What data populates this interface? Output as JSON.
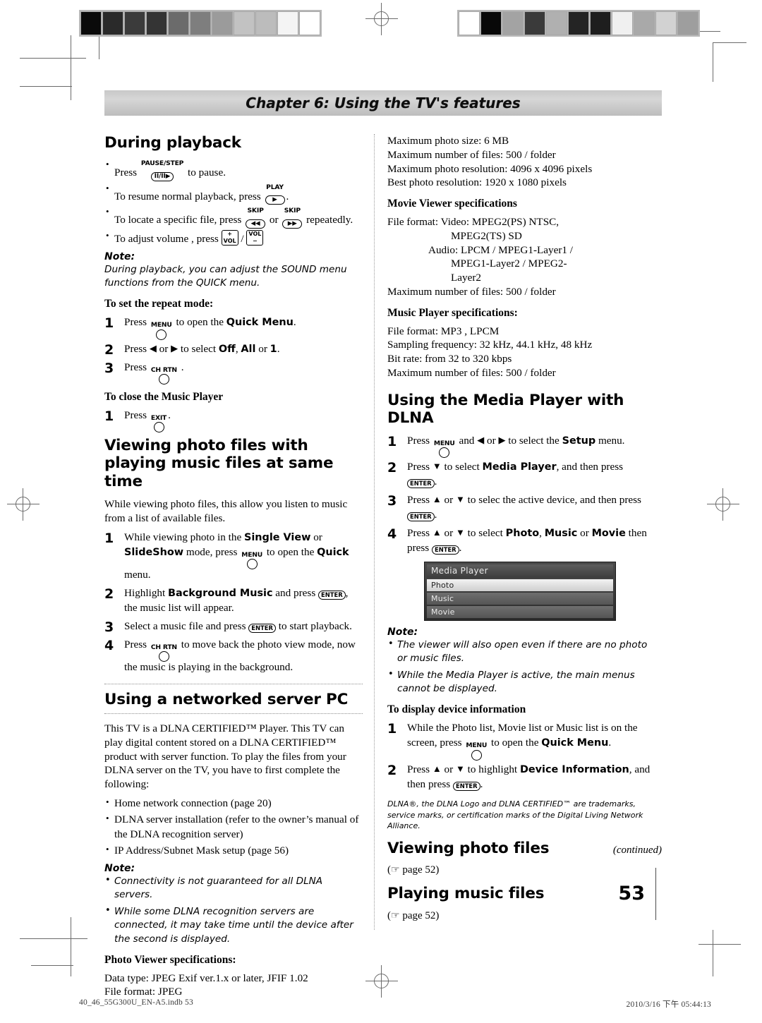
{
  "chapter": {
    "banner": "Chapter 6: Using the TV's features"
  },
  "folio": {
    "page_number": "53",
    "continued": "(continued)"
  },
  "imprint": {
    "file": "40_46_55G300U_EN-A5.indb   53",
    "timestamp": "2010/3/16   下午 05:44:13"
  },
  "calibration": {
    "left_strip": [
      "#0a0a0a",
      "#2a2a2a",
      "#3b3b3b",
      "#343434",
      "#6b6b6b",
      "#7e7e7e",
      "#9b9b9b",
      "#c2c2c2",
      "#bcbcbc",
      "#f4f4f4",
      "#ffffff"
    ],
    "right_strip": [
      "#ffffff",
      "#080808",
      "#a3a3a3",
      "#3a3a3a",
      "#b0b0b0",
      "#242424",
      "#1e1e1e",
      "#f0f0f0",
      "#a9a9a9",
      "#d2d2d2",
      "#9e9e9e"
    ]
  },
  "left_column": {
    "during_playback": {
      "heading": "During playback",
      "bullets": [
        {
          "pre": "Press",
          "key_label": "PAUSE/STEP",
          "key_glyph": "Ⅱ/Ⅱ▶",
          "post": "to pause."
        },
        {
          "pre": "To resume normal playback, press",
          "key_label": "PLAY",
          "key_glyph": "▶",
          "post": "."
        },
        {
          "pre": "To locate a specific file, press",
          "key_label": "SKIP",
          "key_glyph": "◀◀",
          "mid": "or",
          "key_label2": "SKIP",
          "key_glyph2": "▶▶",
          "post": "repeatedly."
        },
        {
          "pre": "To adjust volume , press",
          "key_glyph": "+ VOL",
          "mid": "/",
          "key_glyph2": "VOL −",
          "post": ""
        }
      ],
      "note_label": "Note:",
      "note_text": "During playback, you can adjust the SOUND menu functions from the QUICK menu.",
      "repeat_heading": "To set the repeat mode:",
      "repeat_steps": [
        {
          "num": "1",
          "a": "Press",
          "key": "MENU",
          "b": "to open the",
          "bold": "Quick Menu",
          "c": "."
        },
        {
          "num": "2",
          "a": "Press",
          "b": "or",
          "c": "to select",
          "bold1": "Off",
          "bold2": "All",
          "bold3": "1",
          "d": "."
        },
        {
          "num": "3",
          "a": "Press",
          "key": "CH RTN",
          "b": "."
        }
      ],
      "close_heading": "To close the Music Player",
      "close_steps": [
        {
          "num": "1",
          "a": "Press",
          "key": "EXIT",
          "b": "."
        }
      ]
    },
    "viewing_photo_with_music": {
      "heading": "Viewing photo files with playing music files at same time",
      "intro": "While viewing photo files, this allow you listen to music from a list of available files.",
      "steps": [
        {
          "num": "1",
          "t1": "While viewing photo in the",
          "b1": "Single View",
          "t2": "or",
          "b2": "SlideShow",
          "t3": "mode, press",
          "key": "MENU",
          "t4": "to open the",
          "b3": "Quick",
          "t5": "menu."
        },
        {
          "num": "2",
          "t1": "Highlight",
          "b1": "Background Music",
          "t2": "and press",
          "key2": "ENTER",
          "t3": ", the music list will appear."
        },
        {
          "num": "3",
          "t1": "Select a music file and press",
          "key2": "ENTER",
          "t3": "to start playback."
        },
        {
          "num": "4",
          "t1": "Press",
          "key": "CH RTN",
          "t2": "to move back the photo view mode, now the music is playing in the background."
        }
      ]
    },
    "networked_server": {
      "heading": "Using a networked server PC",
      "intro": "This TV is a DLNA CERTIFIED™ Player. This TV can play digital content stored on a DLNA CERTIFIED™ product with server function. To play the files from your DLNA server on the TV, you have to first complete the following:",
      "bullets": [
        "Home network connection (page 20)",
        "DLNA server installation (refer to the owner’s manual of the DLNA recognition server)",
        "IP Address/Subnet Mask setup (page 56)"
      ],
      "note_label": "Note:",
      "notes": [
        "Connectivity is not guaranteed for all DLNA servers.",
        "While some DLNA recognition servers are connected, it may take time until the device after the second is displayed."
      ],
      "photo_spec_heading": "Photo Viewer specifications:",
      "photo_spec_lines": [
        "Data type: JPEG Exif ver.1.x or later, JFIF 1.02",
        "File format: JPEG"
      ]
    }
  },
  "right_column": {
    "photo_specs_continued": [
      "Maximum photo size: 6 MB",
      "Maximum number of files: 500 / folder",
      "Maximum photo resolution: 4096 x 4096 pixels",
      "Best photo resolution: 1920 x 1080 pixels"
    ],
    "movie_viewer": {
      "heading": "Movie Viewer specifications",
      "lines": [
        {
          "text": "File format: Video: MPEG2(PS) NTSC,",
          "indent": 0
        },
        {
          "text": "MPEG2(TS) SD",
          "indent": 2
        },
        {
          "text": "Audio: LPCM / MPEG1-Layer1 /",
          "indent": 1
        },
        {
          "text": "MPEG1-Layer2 / MPEG2-",
          "indent": 2
        },
        {
          "text": "Layer2",
          "indent": 2
        },
        {
          "text": "Maximum number of files: 500 / folder",
          "indent": 0
        }
      ]
    },
    "music_player": {
      "heading": "Music Player specifications:",
      "lines": [
        "File format: MP3 , LPCM",
        "Sampling frequency: 32 kHz, 44.1 kHz, 48 kHz",
        "Bit rate: from 32 to 320 kbps",
        "Maximum number of files: 500 / folder"
      ]
    },
    "media_player_dlna": {
      "heading": "Using the Media Player with DLNA",
      "steps": [
        {
          "num": "1",
          "t1": "Press",
          "key": "MENU",
          "t2": "and",
          "t3": "or",
          "t4": "to select the",
          "b1": "Setup",
          "t5": "menu."
        },
        {
          "num": "2",
          "t1": "Press",
          "t2": "to select",
          "b1": "Media Player",
          "t3": ", and then press",
          "key2": "ENTER",
          "t4": "."
        },
        {
          "num": "3",
          "t1": "Press",
          "t2": "or",
          "t3": "to selec the active device, and then press",
          "key2": "ENTER",
          "t4": "."
        },
        {
          "num": "4",
          "t1": "Press",
          "t2": "or",
          "t3": "to select",
          "b1": "Photo",
          "b2": "Music",
          "b3": "Movie",
          "t4": "then press",
          "key2": "ENTER",
          "t5": "."
        }
      ],
      "screenshot": {
        "title": "Media Player",
        "items": [
          {
            "label": "Photo",
            "selected": true
          },
          {
            "label": "Music",
            "selected": false
          },
          {
            "label": "Movie",
            "selected": false
          }
        ]
      },
      "note_label": "Note:",
      "notes": [
        "The viewer will also open even if there are no photo or music files.",
        "While the Media Player is active, the main menus cannot be displayed."
      ],
      "device_info_heading": "To display device information",
      "device_info_steps": [
        {
          "num": "1",
          "t1": "While the Photo list, Movie list or Music list is on the screen, press",
          "key": "MENU",
          "t2": "to open the",
          "b1": "Quick Menu",
          "t3": "."
        },
        {
          "num": "2",
          "t1": "Press",
          "t2": "or",
          "t3": "to highlight",
          "b1": "Device Information",
          "t4": ", and then press",
          "key2": "ENTER",
          "t5": "."
        }
      ]
    },
    "trademark": "DLNA®, the DLNA Logo and DLNA CERTIFIED™ are trademarks, service marks, or certification marks of the Digital Living Network Alliance.",
    "viewing_photo_files": {
      "heading": "Viewing photo files",
      "pageref": "page 52"
    },
    "playing_music_files": {
      "heading": "Playing music files",
      "pageref": "page 52"
    }
  }
}
